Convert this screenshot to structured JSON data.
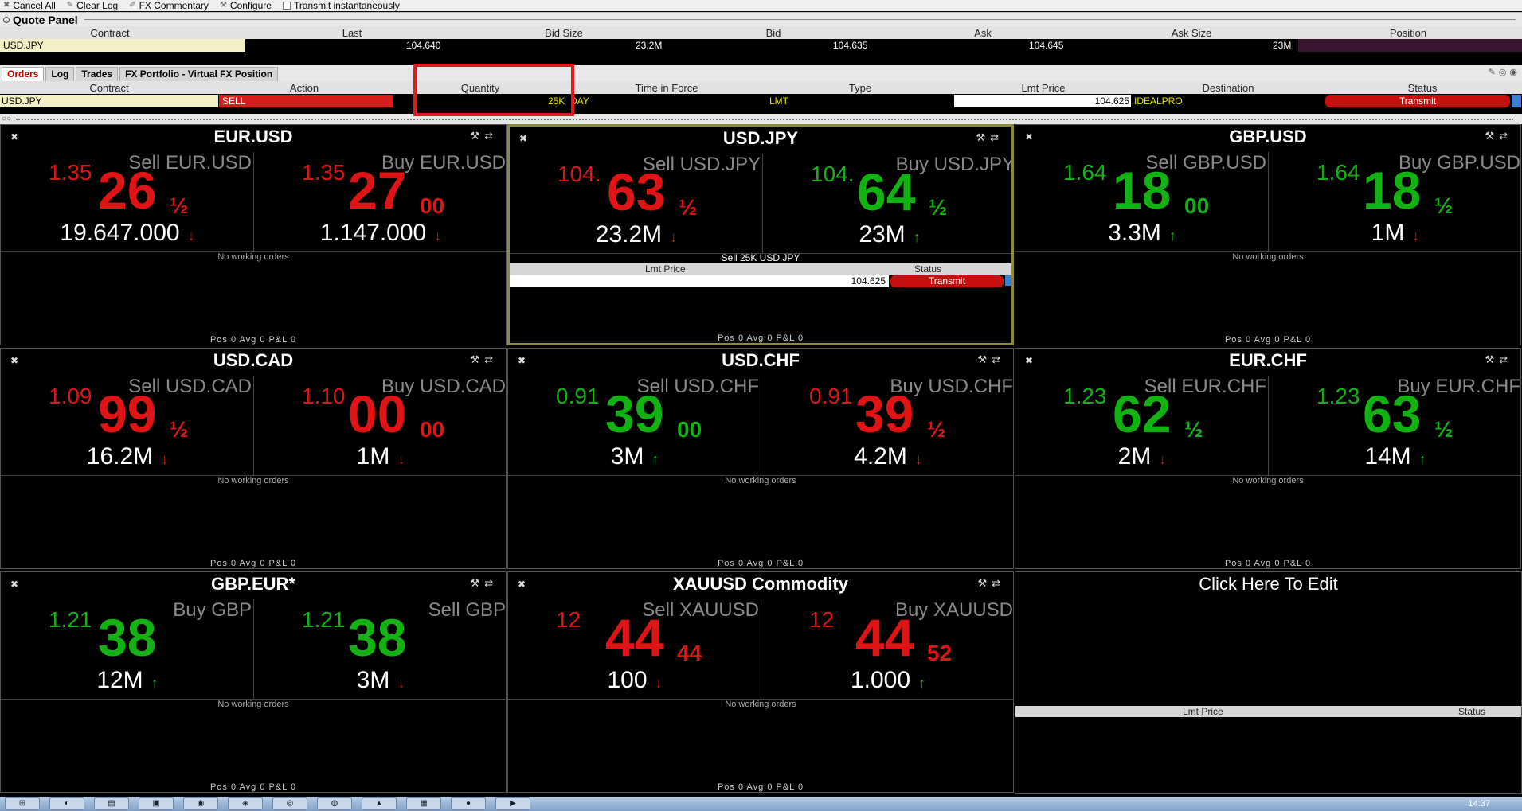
{
  "toolbar": {
    "items": [
      {
        "label": "Cancel All",
        "icon": "cancel-icon"
      },
      {
        "label": "Clear Log",
        "icon": "eraser-icon"
      },
      {
        "label": "FX Commentary",
        "icon": "commentary-icon"
      },
      {
        "label": "Configure",
        "icon": "wrench-icon"
      },
      {
        "label": "Transmit instantaneously",
        "icon": "checkbox"
      }
    ]
  },
  "quote_panel": {
    "title": "Quote Panel",
    "columns": [
      "Contract",
      "Last",
      "Bid Size",
      "Bid",
      "Ask",
      "Ask Size",
      "Position"
    ],
    "row": {
      "contract": "USD.JPY",
      "last": "104.640",
      "bid_size": "23.2M",
      "bid": "104.635",
      "ask": "104.645",
      "ask_size": "23M",
      "position": ""
    }
  },
  "orders": {
    "tabs": [
      "Orders",
      "Log",
      "Trades",
      "FX Portfolio - Virtual FX Position"
    ],
    "active_tab": "Orders",
    "columns": [
      "Contract",
      "Action",
      "Quantity",
      "Time in Force",
      "Type",
      "Lmt Price",
      "Destination",
      "Status"
    ],
    "row": {
      "contract": "USD.JPY",
      "action": "SELL",
      "quantity": "25K",
      "tif": "DAY",
      "type": "LMT",
      "lmt_price": "104.625",
      "destination": "IDEALPRO",
      "status": "Transmit"
    }
  },
  "panels": [
    {
      "title": "EUR.USD",
      "sell": {
        "label": "Sell EUR.USD",
        "pre": "1.35",
        "big": "26",
        "sup": "½",
        "qty": "19.647.000",
        "dir": "down",
        "color": "red"
      },
      "buy": {
        "label": "Buy EUR.USD",
        "pre": "1.35",
        "big": "27",
        "sup": "00",
        "qty": "1.147.000",
        "dir": "down",
        "color": "red"
      },
      "note": "No working orders",
      "footer": "Pos 0   Avg 0   P&L 0"
    },
    {
      "title": "USD.JPY",
      "sell": {
        "label": "Sell USD.JPY",
        "pre": "104.",
        "big": "63",
        "sup": "½",
        "qty": "23.2M",
        "dir": "down",
        "color": "red"
      },
      "buy": {
        "label": "Buy USD.JPY",
        "pre": "104.",
        "big": "64",
        "sup": "½",
        "qty": "23M",
        "dir": "up",
        "color": "grn"
      },
      "order": {
        "title": "Sell 25K USD.JPY",
        "lmt_label": "Lmt Price",
        "status_label": "Status",
        "lmt": "104.625",
        "status": "Transmit"
      },
      "footer": "Pos 0   Avg 0   P&L 0"
    },
    {
      "title": "GBP.USD",
      "sell": {
        "label": "Sell GBP.USD",
        "pre": "1.64",
        "big": "18",
        "sup": "00",
        "qty": "3.3M",
        "dir": "up",
        "color": "grn"
      },
      "buy": {
        "label": "Buy GBP.USD",
        "pre": "1.64",
        "big": "18",
        "sup": "½",
        "qty": "1M",
        "dir": "down",
        "color": "grn"
      },
      "note": "No working orders",
      "footer": "Pos 0   Avg 0   P&L 0"
    },
    {
      "title": "USD.CAD",
      "sell": {
        "label": "Sell USD.CAD",
        "pre": "1.09",
        "big": "99",
        "sup": "½",
        "qty": "16.2M",
        "dir": "down",
        "color": "red"
      },
      "buy": {
        "label": "Buy USD.CAD",
        "pre": "1.10",
        "big": "00",
        "sup": "00",
        "qty": "1M",
        "dir": "down",
        "color": "red"
      },
      "note": "No working orders",
      "footer": "Pos 0   Avg 0   P&L 0"
    },
    {
      "title": "USD.CHF",
      "sell": {
        "label": "Sell USD.CHF",
        "pre": "0.91",
        "big": "39",
        "sup": "00",
        "qty": "3M",
        "dir": "up",
        "color": "grn"
      },
      "buy": {
        "label": "Buy USD.CHF",
        "pre": "0.91",
        "big": "39",
        "sup": "½",
        "qty": "4.2M",
        "dir": "down",
        "color": "red"
      },
      "note": "No working orders",
      "footer": "Pos 0   Avg 0   P&L 0"
    },
    {
      "title": "EUR.CHF",
      "sell": {
        "label": "Sell EUR.CHF",
        "pre": "1.23",
        "big": "62",
        "sup": "½",
        "qty": "2M",
        "dir": "down",
        "color": "grn"
      },
      "buy": {
        "label": "Buy EUR.CHF",
        "pre": "1.23",
        "big": "63",
        "sup": "½",
        "qty": "14M",
        "dir": "up",
        "color": "grn"
      },
      "note": "No working orders",
      "footer": "Pos 0   Avg 0   P&L 0"
    },
    {
      "title": "GBP.EUR*",
      "sell": {
        "label": "Buy GBP",
        "pre": "1.21",
        "big": "38",
        "sup": "",
        "qty": "12M",
        "dir": "up",
        "color": "grn"
      },
      "buy": {
        "label": "Sell GBP",
        "pre": "1.21",
        "big": "38",
        "sup": "",
        "qty": "3M",
        "dir": "down",
        "color": "grn"
      },
      "note": "No working orders",
      "footer": "Pos 0   Avg 0   P&L 0"
    },
    {
      "title": "XAUUSD Commodity",
      "sell": {
        "label": "Sell XAUUSD",
        "pre": "12",
        "big": "44",
        "sup": "44",
        "qty": "100",
        "dir": "down",
        "color": "red"
      },
      "buy": {
        "label": "Buy XAUUSD",
        "pre": "12",
        "big": "44",
        "sup": "52",
        "qty": "1.000",
        "dir": "up",
        "color": "red"
      },
      "note": "No working orders",
      "footer": "Pos 0   Avg 0   P&L 0"
    }
  ],
  "empty_panel": {
    "title": "Click Here To Edit",
    "lmt_label": "Lmt Price",
    "status_label": "Status"
  },
  "taskbar": {
    "clock": "14:37"
  }
}
